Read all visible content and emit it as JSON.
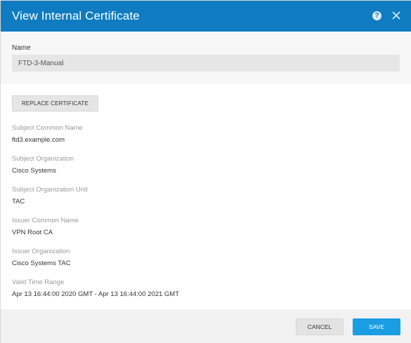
{
  "dialog": {
    "title": "View Internal Certificate",
    "help_icon": "help-icon",
    "close_icon": "close-icon"
  },
  "name": {
    "label": "Name",
    "value": "FTD-3-Manual"
  },
  "actions": {
    "replace_label": "REPLACE CERTIFICATE"
  },
  "fields": [
    {
      "label": "Subject Common Name",
      "value": "ftd3.example.com"
    },
    {
      "label": "Subject Organization",
      "value": "Cisco Systems"
    },
    {
      "label": "Subject Organization Unit",
      "value": "TAC"
    },
    {
      "label": "Issuer Common Name",
      "value": "VPN Root CA"
    },
    {
      "label": "Issuer Organization",
      "value": "Cisco Systems TAC"
    },
    {
      "label": "Valid Time Range",
      "value": "Apr 13 16:44:00 2020 GMT - Apr 13 16:44:00 2021 GMT"
    }
  ],
  "footer": {
    "cancel_label": "CANCEL",
    "save_label": "SAVE"
  },
  "colors": {
    "header": "#0f7cc1",
    "save_button": "#1a9de2"
  }
}
